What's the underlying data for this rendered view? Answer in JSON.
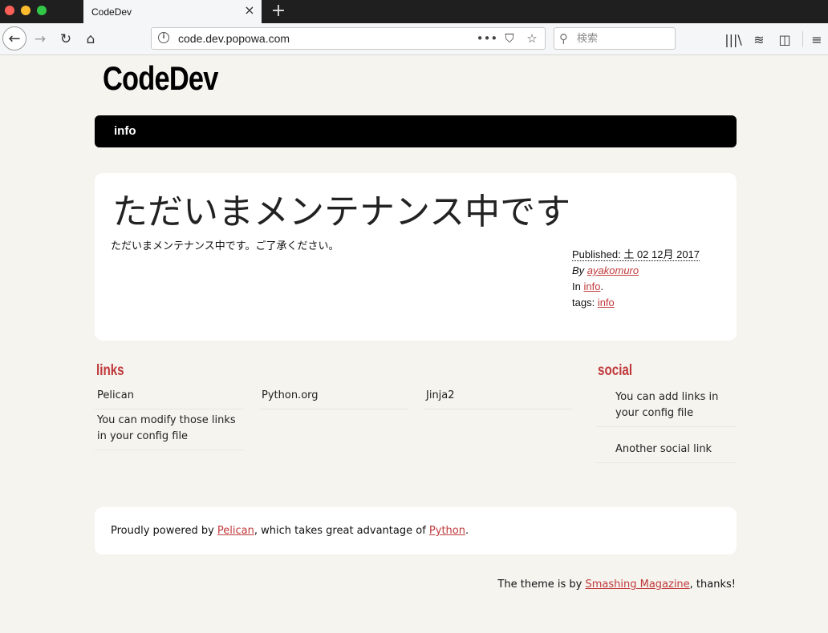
{
  "browser": {
    "tab_title": "CodeDev",
    "tab_close": "×",
    "new_tab": "+",
    "url": "code.dev.popowa.com",
    "search_placeholder": "検索",
    "icons": [
      "back-icon",
      "forward-icon",
      "reload-icon",
      "home-icon",
      "info-icon",
      "more-icon",
      "pocket-icon",
      "bookmark-star-icon",
      "search-icon",
      "library-icon",
      "layers-icon",
      "sidebar-icon",
      "hamburger-menu-icon"
    ],
    "glyphs": {
      "back": "←",
      "forward": "→",
      "reload": "↻",
      "home": "⌂",
      "info": "i",
      "more": "•••",
      "pocket": "⛉",
      "star": "☆",
      "search": "⚲",
      "library": "|||\\",
      "layers": "≋",
      "sidebar": "◫",
      "menu": "≡"
    }
  },
  "site": {
    "title": "CodeDev",
    "menu": [
      {
        "label": "info"
      }
    ]
  },
  "article": {
    "title": "ただいまメンテナンス中です",
    "body": "ただいまメンテナンス中です。ご了承ください。",
    "published_label": "Published:",
    "published_date": "土 02 12月 2017",
    "by_label": "By",
    "author": "ayakomuro",
    "in_label": "In",
    "category": "info",
    "tags_label": "tags:",
    "tag": "info"
  },
  "blogroll": {
    "heading": "links",
    "items": [
      {
        "label": "Pelican"
      },
      {
        "label": "Python.org"
      },
      {
        "label": "Jinja2"
      },
      {
        "label": "You can modify those links in your config file"
      }
    ]
  },
  "social": {
    "heading": "social",
    "items": [
      {
        "label": "You can add links in your config file"
      },
      {
        "label": "Another social link"
      }
    ]
  },
  "footer": {
    "powered_prefix": "Proudly powered by",
    "pelican": "Pelican",
    "powered_middle": ", which takes great advantage of",
    "python": "Python",
    "powered_suffix": ".",
    "theme_prefix": "The theme is by",
    "theme_author": "Smashing Magazine",
    "theme_suffix": ", thanks!"
  },
  "colors": {
    "background": "#f5f4ef",
    "accent": "#c0393b",
    "menu_bar": "#000000",
    "panel": "#ffffff"
  }
}
